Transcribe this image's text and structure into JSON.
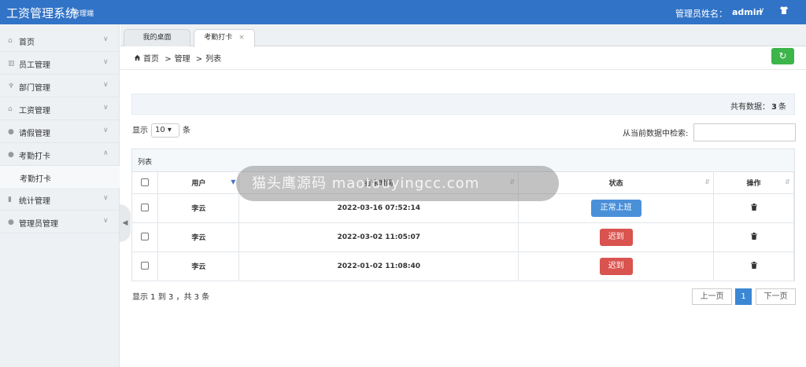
{
  "header": {
    "title": "工资管理系统",
    "subtitle": "管理端",
    "admin_label": "管理员姓名：",
    "admin_name": "admin",
    "caret": "∨"
  },
  "sidebar": {
    "items": [
      {
        "label": "首页",
        "icon": "home-icon"
      },
      {
        "label": "员工管理",
        "icon": "building-icon"
      },
      {
        "label": "部门管理",
        "icon": "trophy-icon"
      },
      {
        "label": "工资管理",
        "icon": "bank-icon"
      },
      {
        "label": "请假管理",
        "icon": "user-icon"
      },
      {
        "label": "考勤打卡",
        "icon": "user-icon",
        "expanded": true
      },
      {
        "label": "统计管理",
        "icon": "chart-icon"
      },
      {
        "label": "管理员管理",
        "icon": "user-icon"
      }
    ],
    "sub_item": "考勤打卡"
  },
  "tabs": [
    {
      "label": "我的桌面"
    },
    {
      "label": "考勤打卡",
      "close": "×",
      "active": true
    }
  ],
  "breadcrumb": {
    "home": "首页",
    "sep": ">",
    "level1": "管理",
    "level2": "列表"
  },
  "total": {
    "prefix": "共有数据：",
    "count": "3",
    "suffix": "条"
  },
  "length": {
    "prefix": "显示",
    "value": "10",
    "suffix": "条"
  },
  "search": {
    "label": "从当前数据中检索:",
    "placeholder": ""
  },
  "panel_title": "列表",
  "table": {
    "headers": [
      "用户",
      "打卡时间",
      "状态",
      "操作"
    ],
    "rows": [
      {
        "user": "李云",
        "time": "2022-03-16 07:52:14",
        "status": "正常上班",
        "status_color": "#4a90d9"
      },
      {
        "user": "李云",
        "time": "2022-03-02 11:05:07",
        "status": "迟到",
        "status_color": "#d9534f"
      },
      {
        "user": "李云",
        "time": "2022-01-02 11:08:40",
        "status": "迟到",
        "status_color": "#d9534f"
      }
    ]
  },
  "info": "显示 1 到 3 ，共 3 条",
  "pagination": {
    "prev": "上一页",
    "current": "1",
    "next": "下一页"
  },
  "watermark": "猫头鹰源码 maotouyingcc.com",
  "colors": {
    "header": "#3173c7",
    "success": "#3cb54a",
    "primary": "#4a90d9",
    "danger": "#d9534f"
  }
}
